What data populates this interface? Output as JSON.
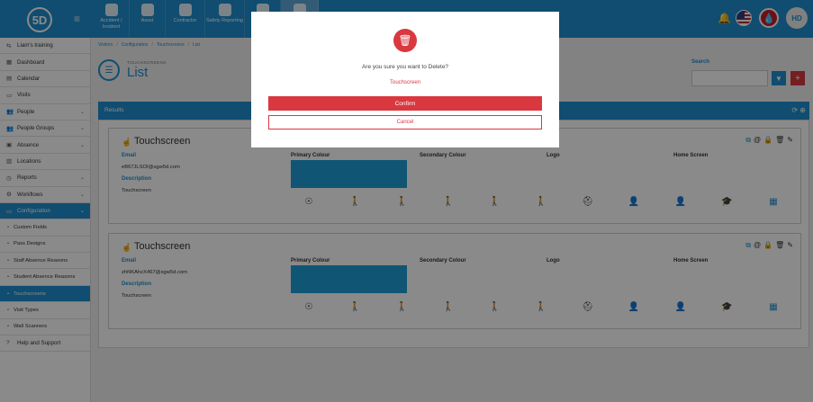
{
  "app": {
    "logo_text": "5D"
  },
  "topnav": [
    {
      "label": "Accident / Incident",
      "icon": "first-aid-icon"
    },
    {
      "label": "Asset",
      "icon": "asset-icon"
    },
    {
      "label": "Contractor",
      "icon": "hardhat-icon"
    },
    {
      "label": "Safety Reporting",
      "icon": "safety-reporting-icon"
    },
    {
      "label": "",
      "icon": "user-icon"
    },
    {
      "label": "",
      "icon": "fingerprint-icon"
    }
  ],
  "user": {
    "initials": "HD"
  },
  "sidebar": {
    "items": [
      {
        "label": "Liam's training",
        "icon": "⇆"
      },
      {
        "label": "Dashboard",
        "icon": "▦"
      },
      {
        "label": "Calendar",
        "icon": "▤"
      },
      {
        "label": "Visits",
        "icon": "▭"
      },
      {
        "label": "People",
        "icon": "👥",
        "chevron": "⌄"
      },
      {
        "label": "People Groups",
        "icon": "👥",
        "chevron": "⌄"
      },
      {
        "label": "Absence",
        "icon": "▣",
        "chevron": "⌄"
      },
      {
        "label": "Locations",
        "icon": "▥"
      },
      {
        "label": "Reports",
        "icon": "◷",
        "chevron": "⌄"
      },
      {
        "label": "Workflows",
        "icon": "⚙",
        "chevron": "⌄"
      },
      {
        "label": "Configuration",
        "icon": "▭",
        "chevron": "⌄",
        "active": true
      },
      {
        "label": "Custom Fields",
        "sub": true
      },
      {
        "label": "Pass Designs",
        "sub": true
      },
      {
        "label": "Staff Absence Reasons",
        "sub": true
      },
      {
        "label": "Student Absence Reasons",
        "sub": true
      },
      {
        "label": "Touchscreens",
        "sub": true,
        "active": true
      },
      {
        "label": "Visit Types",
        "sub": true
      },
      {
        "label": "Wall Scanners",
        "sub": true
      },
      {
        "label": "Help and Support",
        "icon": "?"
      }
    ]
  },
  "breadcrumb": [
    "Visitors",
    "Configuration",
    "Touchscreens",
    "List"
  ],
  "page": {
    "section": "TOUCHSCREENS",
    "title": "List"
  },
  "search": {
    "label": "Search",
    "value": ""
  },
  "results": {
    "label": "Results"
  },
  "cards": [
    {
      "title": "Touchscreen",
      "headers": {
        "email": "Email",
        "primary": "Primary Colour",
        "secondary": "Secondary Colour",
        "logo": "Logo",
        "home": "Home Screen"
      },
      "email": "eB67JLSOI@sgw5d.com",
      "description_label": "Description",
      "description": "Touchscreen",
      "primary_colour": "#1e9fd6"
    },
    {
      "title": "Touchscreen",
      "headers": {
        "email": "Email",
        "primary": "Primary Colour",
        "secondary": "Secondary Colour",
        "logo": "Logo",
        "home": "Home Screen"
      },
      "email": "zhNKAhzX467@sgw5d.com",
      "description_label": "Description",
      "description": "Touchscreen",
      "primary_colour": "#1e9fd6"
    }
  ],
  "modal": {
    "question": "Are you sure you want to Delete?",
    "target": "Touchscreen",
    "confirm_label": "Confirm",
    "cancel_label": "Cancel"
  },
  "colors": {
    "brand": "#1e8fd0",
    "danger": "#d9383f"
  }
}
